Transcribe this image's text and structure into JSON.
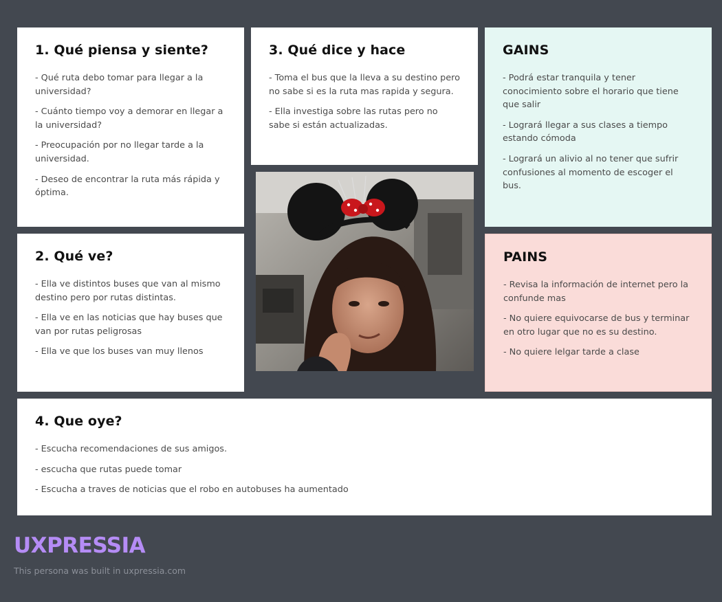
{
  "quadrants": {
    "thinks": {
      "title": "1. Qué piensa y siente?",
      "items": [
        "- Qué ruta debo tomar para llegar a la universidad?",
        "- Cuánto tiempo voy a demorar en llegar a la universidad?",
        "- Preocupación por no llegar tarde a la universidad.",
        "- Deseo de encontrar la ruta más rápida y óptima."
      ]
    },
    "says": {
      "title": "3. Qué dice y hace",
      "items": [
        "- Toma el bus que la lleva a su destino pero no sabe si es la ruta mas rapida y segura.",
        "- Ella investiga sobre las rutas pero no sabe si están actualizadas."
      ]
    },
    "gains": {
      "title": "GAINS",
      "items": [
        "- Podrá estar tranquila y tener conocimiento sobre el horario que tiene que salir",
        "- Logrará llegar a sus clases a tiempo estando cómoda",
        "- Logrará un alivio al no tener que sufrir confusiones al momento de escoger el bus."
      ]
    },
    "sees": {
      "title": "2. Qué ve?",
      "items": [
        "- Ella ve distintos buses que van al mismo destino pero por rutas distintas.",
        "- Ella ve en las noticias que hay buses que van por rutas peligrosas",
        "- Ella ve que los buses van muy llenos"
      ]
    },
    "pains": {
      "title": "PAINS",
      "items": [
        "- Revisa la información de internet pero la confunde mas",
        "- No quiere equivocarse de bus y terminar en otro lugar que no es su destino.",
        "- No quiere lelgar tarde a clase"
      ]
    },
    "hears": {
      "title": "4. Que oye?",
      "items": [
        "- Escucha recomendaciones de sus amigos.",
        "- escucha que rutas puede tomar",
        "- Escucha a traves de noticias que el robo en autobuses ha aumentado"
      ]
    }
  },
  "persona_photo": {
    "icon": "persona-photo"
  },
  "footer": {
    "brand": "UXPRESSIA",
    "note": "This persona was built in uxpressia.com"
  },
  "colors": {
    "background": "#434850",
    "card": "#ffffff",
    "gains": "#e5f7f3",
    "pains": "#fadcd9",
    "brand": "#b58cf5"
  }
}
